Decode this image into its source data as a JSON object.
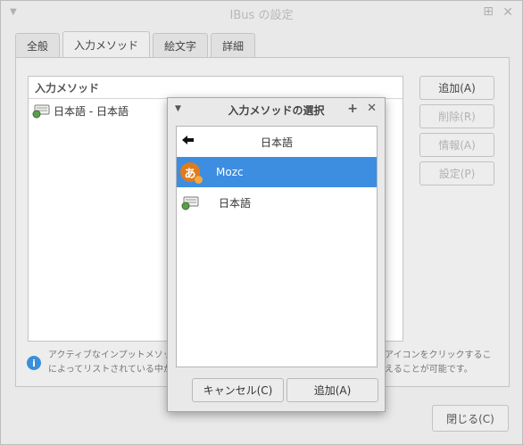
{
  "window": {
    "title": "IBus の設定",
    "menu_glyph": "▼",
    "maximize_glyph": "⊞",
    "close_glyph": "✕"
  },
  "tabs": [
    {
      "label": "全般"
    },
    {
      "label": "入力メソッド"
    },
    {
      "label": "絵文字"
    },
    {
      "label": "詳細"
    }
  ],
  "main": {
    "list_header": "入力メソッド",
    "items": [
      {
        "label": "日本語 - 日本語",
        "icon": "keyboard-icon"
      }
    ],
    "buttons": {
      "add": "追加(A)",
      "remove": "削除(R)",
      "info": "情報(A)",
      "settings": "設定(P)"
    },
    "info_text_left": [
      "アクティブなインプットメソッ",
      "によってリストされている中か"
    ],
    "info_text_right": [
      "アイコンをクリックするこ",
      "えることが可能です。"
    ],
    "info_icon": "i",
    "close_button": "閉じる(C)"
  },
  "dialog": {
    "title": "入力メソッドの選択",
    "menu_glyph": "▼",
    "pin_glyph": "+",
    "close_glyph": "✕",
    "back_glyph": "🡐",
    "back_label": "日本語",
    "items": [
      {
        "label": "Mozc",
        "icon": "mozc-icon",
        "selected": true
      },
      {
        "label": "日本語",
        "icon": "keyboard-icon",
        "selected": false
      }
    ],
    "mozc_glyph": "あ",
    "cancel_button": "キャンセル(C)",
    "add_button": "追加(A)"
  },
  "colors": {
    "selection": "#3d8ee0",
    "info_icon": "#3b8fd9",
    "mozc_icon": "#e07b1c"
  }
}
